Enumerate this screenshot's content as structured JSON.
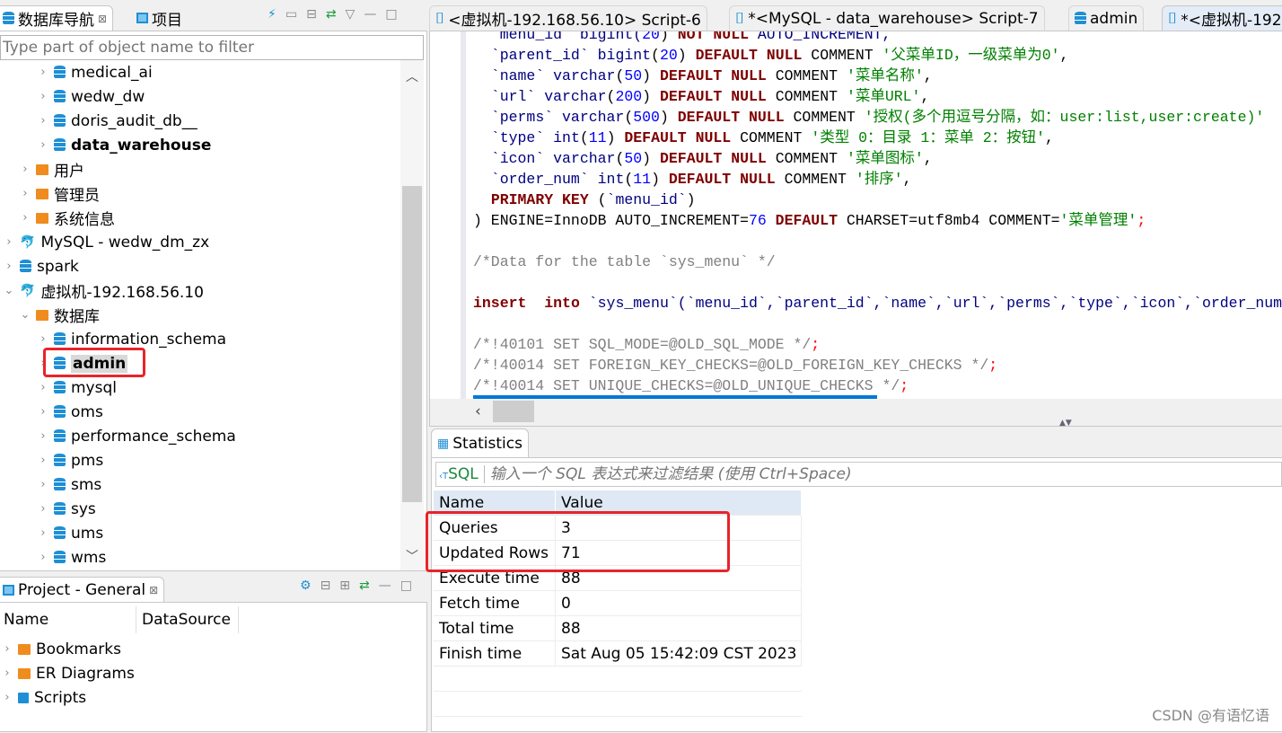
{
  "navigator": {
    "tabs": [
      {
        "label": "数据库导航",
        "icon": "database-icon",
        "close": "⊠"
      },
      {
        "label": "项目",
        "icon": "project-icon"
      }
    ],
    "filter_placeholder": "Type part of object name to filter",
    "tree": [
      {
        "label": "medical_ai",
        "level": 3,
        "icon": "database"
      },
      {
        "label": "wedw_dw",
        "level": 3,
        "icon": "database"
      },
      {
        "label": "doris_audit_db__",
        "level": 3,
        "icon": "database"
      },
      {
        "label": "data_warehouse",
        "level": 3,
        "icon": "database",
        "bold": true
      },
      {
        "label": "用户",
        "level": 2,
        "icon": "users-folder"
      },
      {
        "label": "管理员",
        "level": 2,
        "icon": "admin-folder"
      },
      {
        "label": "系统信息",
        "level": 2,
        "icon": "info-folder"
      },
      {
        "label": "MySQL - wedw_dm_zx",
        "level": 1,
        "icon": "mysql"
      },
      {
        "label": "spark",
        "level": 1,
        "icon": "database"
      },
      {
        "label": "虚拟机-192.168.56.10",
        "level": 1,
        "icon": "mysql",
        "expanded": true
      },
      {
        "label": "数据库",
        "level": 2,
        "icon": "folder",
        "expanded": true
      },
      {
        "label": "information_schema",
        "level": 3,
        "icon": "database"
      },
      {
        "label": "admin",
        "level": 3,
        "icon": "database",
        "bold": true,
        "selected": true
      },
      {
        "label": "mysql",
        "level": 3,
        "icon": "database"
      },
      {
        "label": "oms",
        "level": 3,
        "icon": "database"
      },
      {
        "label": "performance_schema",
        "level": 3,
        "icon": "database"
      },
      {
        "label": "pms",
        "level": 3,
        "icon": "database"
      },
      {
        "label": "sms",
        "level": 3,
        "icon": "database"
      },
      {
        "label": "sys",
        "level": 3,
        "icon": "database"
      },
      {
        "label": "ums",
        "level": 3,
        "icon": "database"
      },
      {
        "label": "wms",
        "level": 3,
        "icon": "database"
      }
    ]
  },
  "project": {
    "tab_label": "Project - General",
    "close": "⊠",
    "columns": [
      "Name",
      "DataSource"
    ],
    "items": [
      {
        "label": "Bookmarks",
        "icon": "bookmarks-icon"
      },
      {
        "label": "ER Diagrams",
        "icon": "er-diagram-icon"
      },
      {
        "label": "Scripts",
        "icon": "scripts-icon"
      }
    ]
  },
  "editor": {
    "tabs": [
      {
        "label": "<虚拟机-192.168.56.10> Script-6"
      },
      {
        "label": "*<MySQL - data_warehouse> Script-7"
      },
      {
        "label": "admin"
      },
      {
        "label": "*<虚拟机-192",
        "active": true
      }
    ],
    "lines": [
      [
        [
          "  ",
          "p"
        ],
        [
          "`menu_id`",
          "id"
        ],
        [
          " bigint(",
          "id"
        ],
        [
          "20",
          "n"
        ],
        [
          ") ",
          "p"
        ],
        [
          "NOT NULL",
          "k"
        ],
        [
          " AUTO_INCREMENT,",
          "id"
        ]
      ],
      [
        [
          "  ",
          "p"
        ],
        [
          "`parent_id`",
          "id"
        ],
        [
          " bigint",
          "id"
        ],
        [
          "(",
          "p"
        ],
        [
          "20",
          "n"
        ],
        [
          ") ",
          "p"
        ],
        [
          "DEFAULT NULL",
          "k"
        ],
        [
          " COMMENT ",
          "p"
        ],
        [
          "'父菜单ID，一级菜单为0'",
          "s"
        ],
        [
          ",",
          "p"
        ]
      ],
      [
        [
          "  ",
          "p"
        ],
        [
          "`name`",
          "id"
        ],
        [
          " varchar",
          "id"
        ],
        [
          "(",
          "p"
        ],
        [
          "50",
          "n"
        ],
        [
          ") ",
          "p"
        ],
        [
          "DEFAULT NULL",
          "k"
        ],
        [
          " COMMENT ",
          "p"
        ],
        [
          "'菜单名称'",
          "s"
        ],
        [
          ",",
          "p"
        ]
      ],
      [
        [
          "  ",
          "p"
        ],
        [
          "`url`",
          "id"
        ],
        [
          " varchar",
          "id"
        ],
        [
          "(",
          "p"
        ],
        [
          "200",
          "n"
        ],
        [
          ") ",
          "p"
        ],
        [
          "DEFAULT NULL",
          "k"
        ],
        [
          " COMMENT ",
          "p"
        ],
        [
          "'菜单URL'",
          "s"
        ],
        [
          ",",
          "p"
        ]
      ],
      [
        [
          "  ",
          "p"
        ],
        [
          "`perms`",
          "id"
        ],
        [
          " varchar",
          "id"
        ],
        [
          "(",
          "p"
        ],
        [
          "500",
          "n"
        ],
        [
          ") ",
          "p"
        ],
        [
          "DEFAULT NULL",
          "k"
        ],
        [
          " COMMENT ",
          "p"
        ],
        [
          "'授权(多个用逗号分隔，如：user:list,user:create)'",
          "s"
        ]
      ],
      [
        [
          "  ",
          "p"
        ],
        [
          "`type`",
          "id"
        ],
        [
          " int",
          "id"
        ],
        [
          "(",
          "p"
        ],
        [
          "11",
          "n"
        ],
        [
          ") ",
          "p"
        ],
        [
          "DEFAULT NULL",
          "k"
        ],
        [
          " COMMENT ",
          "p"
        ],
        [
          "'类型 0：目录 1：菜单 2：按钮'",
          "s"
        ],
        [
          ",",
          "p"
        ]
      ],
      [
        [
          "  ",
          "p"
        ],
        [
          "`icon`",
          "id"
        ],
        [
          " varchar",
          "id"
        ],
        [
          "(",
          "p"
        ],
        [
          "50",
          "n"
        ],
        [
          ") ",
          "p"
        ],
        [
          "DEFAULT NULL",
          "k"
        ],
        [
          " COMMENT ",
          "p"
        ],
        [
          "'菜单图标'",
          "s"
        ],
        [
          ",",
          "p"
        ]
      ],
      [
        [
          "  ",
          "p"
        ],
        [
          "`order_num`",
          "id"
        ],
        [
          " int",
          "id"
        ],
        [
          "(",
          "p"
        ],
        [
          "11",
          "n"
        ],
        [
          ") ",
          "p"
        ],
        [
          "DEFAULT NULL",
          "k"
        ],
        [
          " COMMENT ",
          "p"
        ],
        [
          "'排序'",
          "s"
        ],
        [
          ",",
          "p"
        ]
      ],
      [
        [
          "  ",
          "p"
        ],
        [
          "PRIMARY KEY",
          "k"
        ],
        [
          " (",
          "p"
        ],
        [
          "`menu_id`",
          "id"
        ],
        [
          ")",
          "p"
        ]
      ],
      [
        [
          ") ENGINE=InnoDB AUTO_INCREMENT=",
          "p"
        ],
        [
          "76",
          "n"
        ],
        [
          " ",
          "p"
        ],
        [
          "DEFAULT",
          "k"
        ],
        [
          " CHARSET=utf8mb4 COMMENT=",
          "p"
        ],
        [
          "'菜单管理'",
          "s"
        ],
        [
          ";",
          "r"
        ]
      ],
      [],
      [
        [
          "/*Data for the table `sys_menu` */",
          "c"
        ]
      ],
      [],
      [
        [
          "insert",
          "k"
        ],
        [
          "  ",
          "p"
        ],
        [
          "into",
          "k"
        ],
        [
          " `sys_menu`(`menu_id`,`parent_id`,`name`,`url`,`perms`,`type`,`icon`,`order_num`)",
          "id"
        ]
      ],
      [],
      [
        [
          "/*!40101 SET SQL_MODE=@OLD_SQL_MODE */",
          "c"
        ],
        [
          ";",
          "r"
        ]
      ],
      [
        [
          "/*!40014 SET FOREIGN_KEY_CHECKS=@OLD_FOREIGN_KEY_CHECKS */",
          "c"
        ],
        [
          ";",
          "r"
        ]
      ],
      [
        [
          "/*!40014 SET UNIQUE_CHECKS=@OLD_UNIQUE_CHECKS */",
          "c"
        ],
        [
          ";",
          "r"
        ]
      ]
    ]
  },
  "results": {
    "tab_label": "Statistics",
    "filter_prefix": "SQL",
    "filter_placeholder": "输入一个 SQL 表达式来过滤结果 (使用 Ctrl+Space)",
    "columns": [
      "Name",
      "Value"
    ],
    "rows": [
      [
        "Queries",
        "3"
      ],
      [
        "Updated Rows",
        "71"
      ],
      [
        "Execute time",
        "88"
      ],
      [
        "Fetch time",
        "0"
      ],
      [
        "Total time",
        "88"
      ],
      [
        "Finish time",
        "Sat Aug 05 15:42:09 CST 2023"
      ]
    ]
  },
  "watermark": "CSDN @有语忆语",
  "colors": {
    "highlight_box": "#e8242a",
    "selection": "#0078d7",
    "keyword": "#7f0000",
    "string": "#008000",
    "comment": "#808080"
  }
}
